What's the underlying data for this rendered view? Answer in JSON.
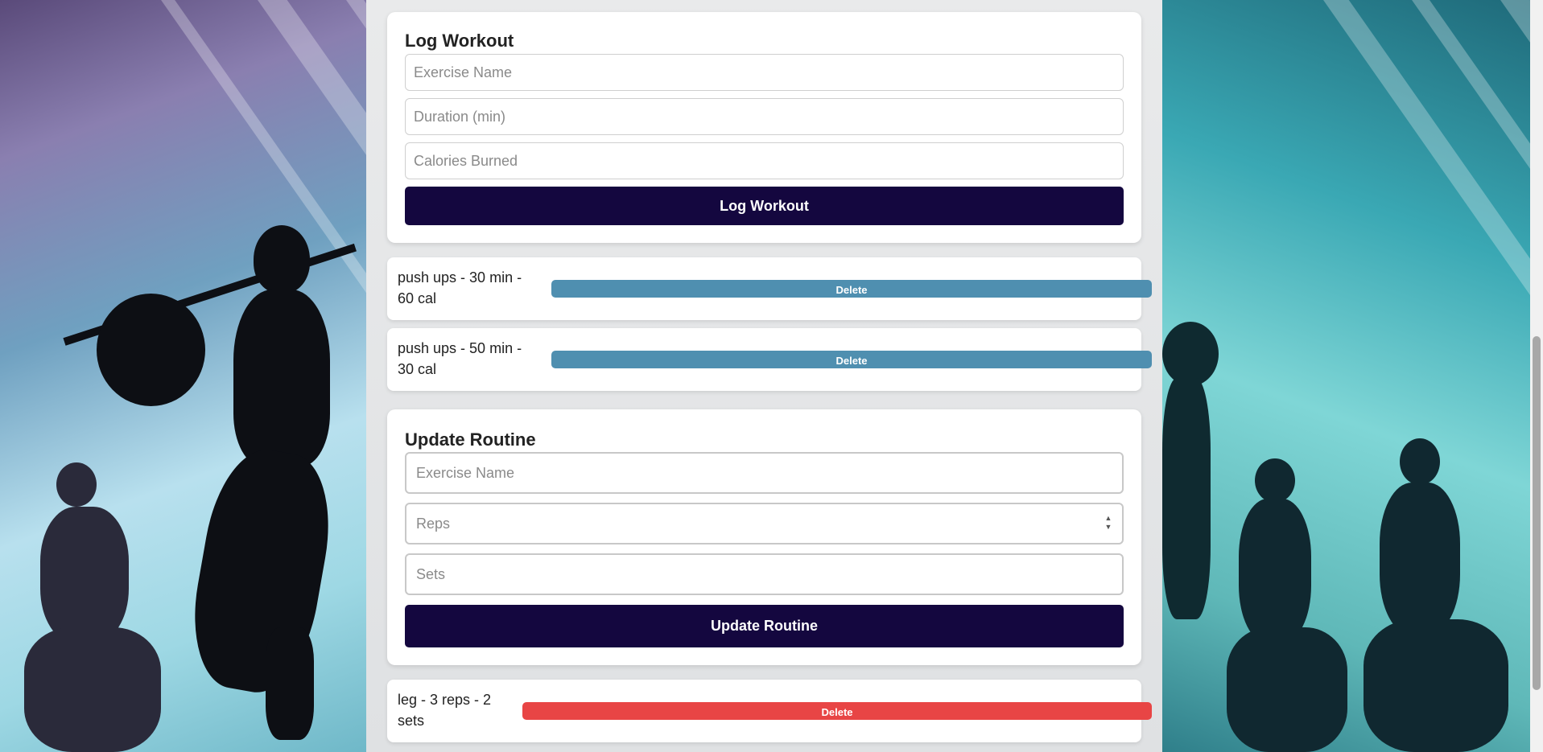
{
  "log_workout": {
    "title": "Log Workout",
    "exercise_placeholder": "Exercise Name",
    "duration_placeholder": "Duration (min)",
    "calories_placeholder": "Calories Burned",
    "submit_label": "Log Workout"
  },
  "workouts": [
    {
      "line1": "push ups - 30 min -",
      "line2": "60 cal",
      "delete_label": "Delete"
    },
    {
      "line1": "push ups - 50 min -",
      "line2": "30 cal",
      "delete_label": "Delete"
    }
  ],
  "update_routine": {
    "title": "Update Routine",
    "exercise_placeholder": "Exercise Name",
    "reps_placeholder": "Reps",
    "sets_placeholder": "Sets",
    "submit_label": "Update Routine"
  },
  "routines": [
    {
      "line1": "leg - 3 reps - 2",
      "line2": "sets",
      "delete_label": "Delete"
    }
  ],
  "colors": {
    "primary_button": "#14073f",
    "workout_delete": "#4f8fb0",
    "routine_delete": "#e84545"
  }
}
